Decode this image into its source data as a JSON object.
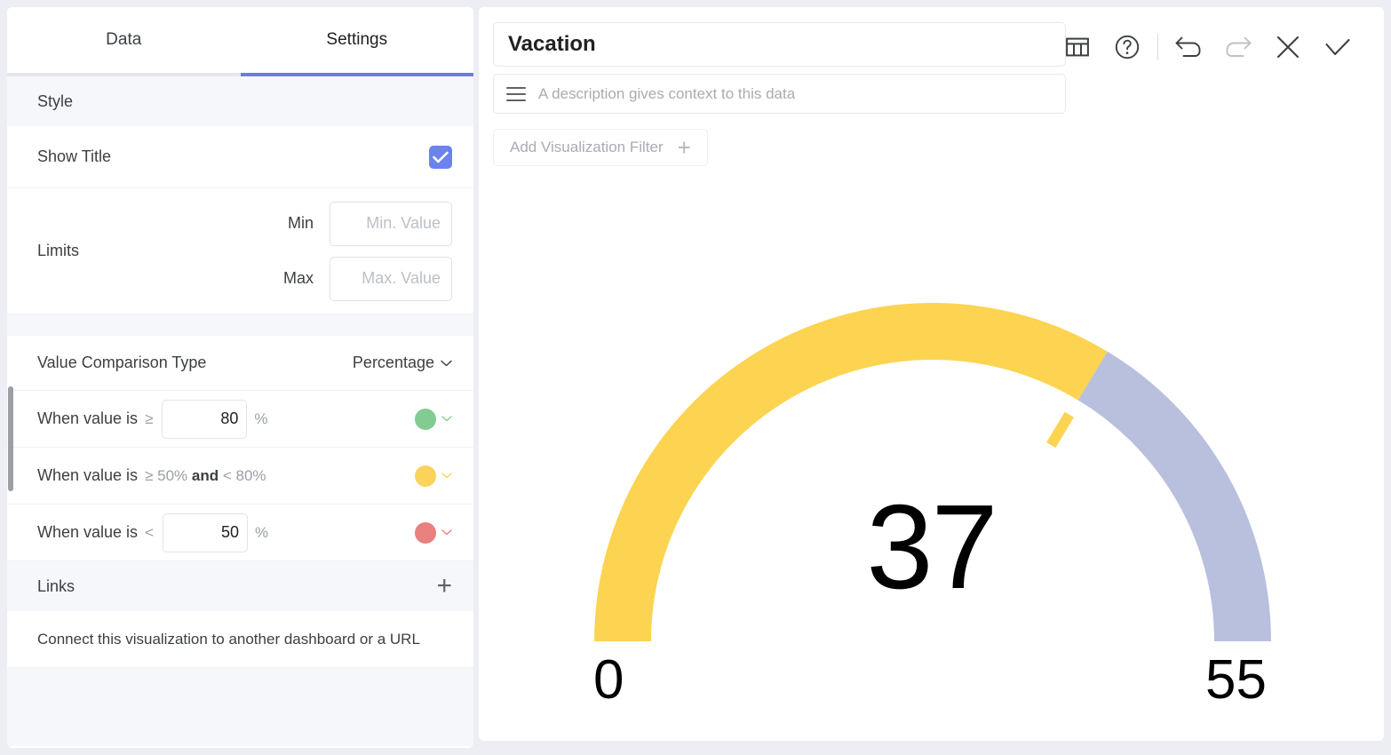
{
  "left_panel": {
    "tabs": [
      {
        "label": "Data",
        "active": false
      },
      {
        "label": "Settings",
        "active": true
      }
    ],
    "style_section": {
      "header": "Style",
      "show_title_label": "Show Title",
      "show_title_checked": true,
      "limits_label": "Limits",
      "min_label": "Min",
      "min_value": "",
      "min_placeholder": "Min. Value",
      "max_label": "Max",
      "max_value": "",
      "max_placeholder": "Max. Value"
    },
    "value_comparison": {
      "label": "Value Comparison Type",
      "value": "Percentage"
    },
    "conditions": [
      {
        "label": "When value is",
        "operator": "≥",
        "value": "80",
        "unit": "%",
        "color": "#82CC91",
        "color_name": "green"
      },
      {
        "label": "When value is",
        "range_text_pre": "≥ 50%",
        "range_text_and": "and",
        "range_text_post": "< 80%",
        "color": "#FBD35B",
        "color_name": "yellow"
      },
      {
        "label": "When value is",
        "operator": "<",
        "value": "50",
        "unit": "%",
        "color": "#E8807E",
        "color_name": "red"
      }
    ],
    "links_section": {
      "header": "Links",
      "add_icon": "plus-icon",
      "description": "Connect this visualization to another dashboard or a URL"
    }
  },
  "right_panel": {
    "title_value": "Vacation",
    "description_value": "",
    "description_placeholder": "A description gives context to this data",
    "filter_button_label": "Add Visualization Filter",
    "toolbar": [
      {
        "name": "table-view-icon",
        "label": "Table view"
      },
      {
        "name": "help-icon",
        "label": "Help"
      },
      {
        "name": "undo-icon",
        "label": "Undo",
        "enabled": true
      },
      {
        "name": "redo-icon",
        "label": "Redo",
        "enabled": false
      },
      {
        "name": "close-icon",
        "label": "Cancel"
      },
      {
        "name": "check-icon",
        "label": "Apply"
      }
    ]
  },
  "chart_data": {
    "type": "gauge",
    "title": "Vacation",
    "value": 37,
    "min": 0,
    "max": 55,
    "min_label": "0",
    "max_label": "55",
    "value_label": "37",
    "percent_of_max": 67.3,
    "progress_color": "#FCD451",
    "track_color": "#B9C0DE",
    "needle_color": "#FCD451",
    "start_angle": 180,
    "end_angle": 0,
    "legend": "none",
    "grid": false
  }
}
